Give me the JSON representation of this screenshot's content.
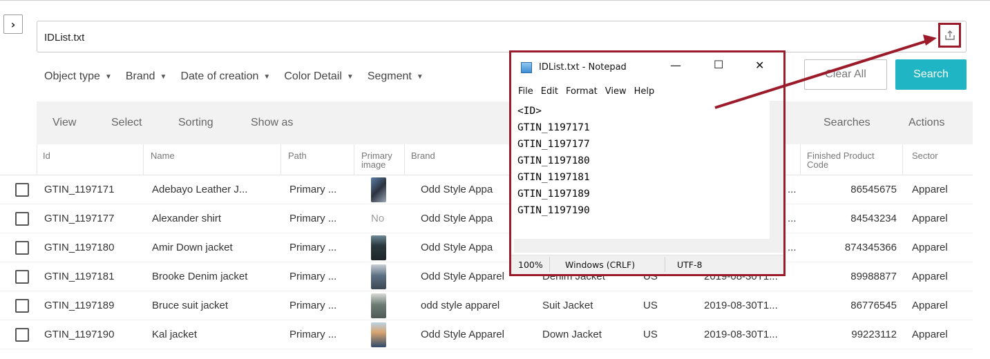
{
  "file_field": {
    "value": "IDList.txt"
  },
  "filters": [
    "Object type",
    "Brand",
    "Date of creation",
    "Color Detail",
    "Segment"
  ],
  "buttons": {
    "clear_all": "Clear All",
    "search": "Search"
  },
  "toolbar": {
    "view": "View",
    "select": "Select",
    "sorting": "Sorting",
    "show_as": "Show as",
    "searches": "Searches",
    "actions": "Actions"
  },
  "table": {
    "headers": {
      "id": "Id",
      "name": "Name",
      "path": "Path",
      "primary_image": "Primary image",
      "brand": "Brand",
      "finished_product_code": "Finished Product Code",
      "sector": "Sector"
    },
    "rows": [
      {
        "id": "GTIN_1197171",
        "name": "Adebayo Leather J...",
        "path": "Primary ...",
        "image": "photo",
        "brand": "Odd Style Appa",
        "type": "",
        "country": "",
        "date": "...",
        "code": "86545675",
        "sector": "Apparel"
      },
      {
        "id": "GTIN_1197177",
        "name": "Alexander shirt",
        "path": "Primary ...",
        "image": "No",
        "brand": "Odd Style Appa",
        "type": "",
        "country": "",
        "date": "...",
        "code": "84543234",
        "sector": "Apparel"
      },
      {
        "id": "GTIN_1197180",
        "name": "Amir Down jacket",
        "path": "Primary ...",
        "image": "photo",
        "brand": "Odd Style Appa",
        "type": "",
        "country": "",
        "date": "...",
        "code": "874345366",
        "sector": "Apparel"
      },
      {
        "id": "GTIN_1197181",
        "name": "Brooke Denim jacket",
        "path": "Primary ...",
        "image": "photo",
        "brand": "Odd Style Apparel",
        "type": "Denim Jacket",
        "country": "US",
        "date": "2019-08-30T1...",
        "code": "89988877",
        "sector": "Apparel"
      },
      {
        "id": "GTIN_1197189",
        "name": "Bruce suit jacket",
        "path": "Primary ...",
        "image": "photo",
        "brand": "odd style apparel",
        "type": "Suit Jacket",
        "country": "US",
        "date": "2019-08-30T1...",
        "code": "86776545",
        "sector": "Apparel"
      },
      {
        "id": "GTIN_1197190",
        "name": "Kal jacket",
        "path": "Primary ...",
        "image": "photo",
        "brand": "Odd Style Apparel",
        "type": "Down Jacket",
        "country": "US",
        "date": "2019-08-30T1...",
        "code": "99223112",
        "sector": "Apparel"
      }
    ]
  },
  "notepad": {
    "title": "IDList.txt - Notepad",
    "menu": [
      "File",
      "Edit",
      "Format",
      "View",
      "Help"
    ],
    "lines": [
      "<ID>",
      "GTIN_1197171",
      "GTIN_1197177",
      "GTIN_1197180",
      "GTIN_1197181",
      "GTIN_1197189",
      "GTIN_1197190"
    ],
    "status": {
      "zoom": "100%",
      "eol": "Windows (CRLF)",
      "encoding": "UTF-8"
    }
  },
  "colors": {
    "accent": "#1fb5c4",
    "highlight": "#9b1b2a"
  },
  "icons": {
    "collapse": "chevron-right-icon",
    "upload": "upload-icon"
  }
}
